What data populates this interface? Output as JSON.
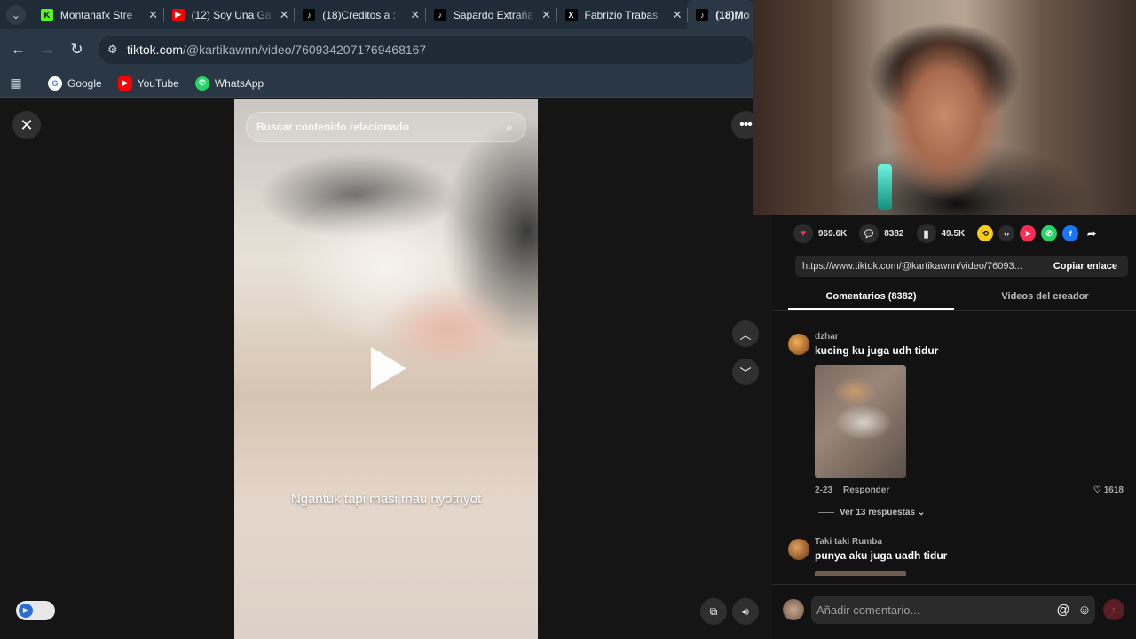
{
  "browser": {
    "tabs": [
      {
        "title": "Montanafx Stre",
        "favicon": "kick-icon",
        "color": "#53fc18"
      },
      {
        "title": "(12) Soy Una Ga",
        "favicon": "youtube-icon",
        "color": "#ff0000"
      },
      {
        "title": "(18)Creditos a :",
        "favicon": "tiktok-icon",
        "color": "#000000"
      },
      {
        "title": "Sapardo Extraña",
        "favicon": "tiktok-icon",
        "color": "#000000"
      },
      {
        "title": "Fabrizio Trabas",
        "favicon": "x-icon",
        "color": "#000000"
      },
      {
        "title": "(18)Mo",
        "favicon": "tiktok-icon",
        "color": "#000000"
      }
    ],
    "url_host": "tiktok.com",
    "url_path": "/@kartikawnn/video/7609342071769468167",
    "bookmarks": [
      {
        "label": "Google",
        "icon": "google-icon"
      },
      {
        "label": "YouTube",
        "icon": "youtube-icon"
      },
      {
        "label": "WhatsApp",
        "icon": "whatsapp-icon"
      }
    ]
  },
  "video": {
    "search_placeholder": "Buscar contenido relacionado",
    "caption": "Ngantuk tapi masi mau nyotnyot"
  },
  "stats": {
    "likes": "969.6K",
    "comments": "8382",
    "saves": "49.5K"
  },
  "share": {
    "link": "https://www.tiktok.com/@kartikawnn/video/76093...",
    "copy_label": "Copiar enlace"
  },
  "panel_tabs": {
    "comments": "Comentarios (8382)",
    "creator_videos": "Videos del creador"
  },
  "comments": [
    {
      "user": "dzhar",
      "text": "kucing ku juga udh tidur",
      "date": "2-23",
      "reply": "Responder",
      "likes": "1618",
      "more_replies": "Ver 13 respuestas"
    },
    {
      "user": "Taki taki Rumba",
      "text": "punya aku juga uadh tidur"
    }
  ],
  "footer": {
    "placeholder": "Añadir comentario..."
  },
  "colors": {
    "like": "#fe2c55",
    "tiktok_bg": "#121212"
  }
}
